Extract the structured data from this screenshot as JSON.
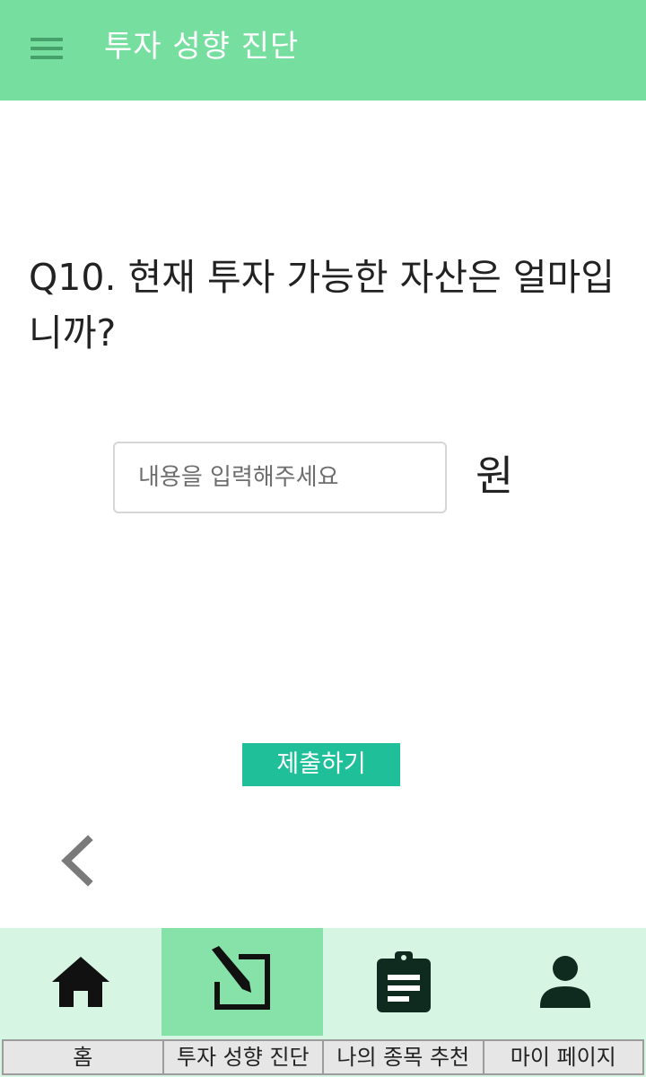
{
  "appbar": {
    "title": "투자 성향 진단",
    "menu_icon": "hamburger-menu-icon"
  },
  "question": {
    "text": "Q10. 현재 투자 가능한 자산은 얼마입니까?"
  },
  "amount": {
    "value": "",
    "placeholder": "내용을 입력해주세요",
    "unit": "원"
  },
  "submit": {
    "label": "제출하기"
  },
  "back": {
    "icon": "chevron-left-icon"
  },
  "bottom_nav": {
    "active_index": 1,
    "items": [
      {
        "icon": "home-icon",
        "label": "홈"
      },
      {
        "icon": "edit-square-icon",
        "label": "투자 성향 진단"
      },
      {
        "icon": "clipboard-icon",
        "label": "나의 종목 추천"
      },
      {
        "icon": "person-icon",
        "label": "마이 페이지"
      }
    ]
  },
  "colors": {
    "appbar": "#76de9f",
    "submit": "#1fbf9a",
    "nav_bg": "#d6f5e3",
    "nav_active": "#86e2a8"
  }
}
